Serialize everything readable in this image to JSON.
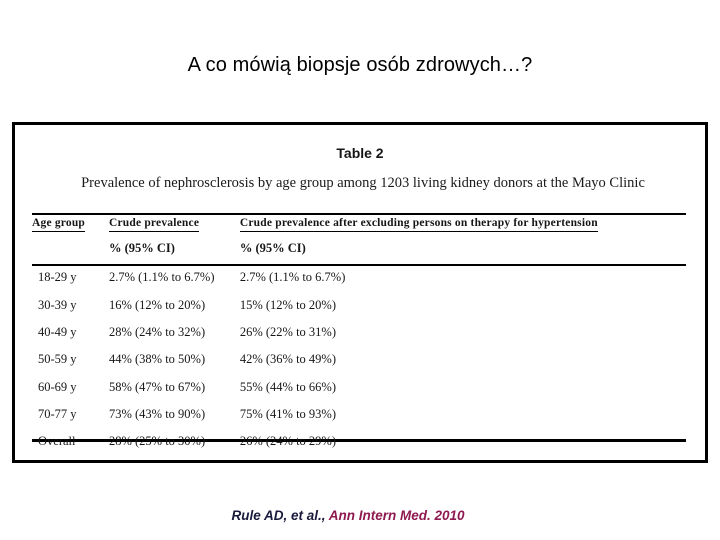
{
  "slide": {
    "title": "A co mówią biopsje osób zdrowych…?"
  },
  "figure": {
    "table_label": "Table 2",
    "caption": "Prevalence of nephrosclerosis by age group among 1203 living kidney donors at the Mayo Clinic",
    "headers": {
      "col1": "Age group",
      "col2": "Crude prevalence",
      "col3": "Crude prevalence after excluding persons on therapy for hypertension",
      "col2_sub": "% (95% CI)",
      "col3_sub": "% (95% CI)"
    },
    "rows": [
      {
        "age_group": "18-29 y",
        "crude_prevalence": "2.7% (1.1% to 6.7%)",
        "crude_prevalence_excl": "2.7% (1.1% to 6.7%)"
      },
      {
        "age_group": "30-39 y",
        "crude_prevalence": "16% (12% to 20%)",
        "crude_prevalence_excl": "15% (12% to 20%)"
      },
      {
        "age_group": "40-49 y",
        "crude_prevalence": "28% (24% to 32%)",
        "crude_prevalence_excl": "26% (22% to 31%)"
      },
      {
        "age_group": "50-59 y",
        "crude_prevalence": "44% (38% to 50%)",
        "crude_prevalence_excl": "42% (36% to 49%)"
      },
      {
        "age_group": "60-69 y",
        "crude_prevalence": "58% (47% to 67%)",
        "crude_prevalence_excl": "55% (44% to 66%)"
      },
      {
        "age_group": "70-77 y",
        "crude_prevalence": "73% (43% to 90%)",
        "crude_prevalence_excl": "75% (41% to 93%)"
      },
      {
        "age_group": "Overall",
        "crude_prevalence": "28% (25% to 30%)",
        "crude_prevalence_excl": "26% (24% to 29%)"
      }
    ]
  },
  "citation": {
    "authors": "Rule AD, et al., ",
    "journal": "Ann Intern Med. 2010",
    "authors_color": "#1a1a3c",
    "journal_color": "#8f1a50"
  }
}
